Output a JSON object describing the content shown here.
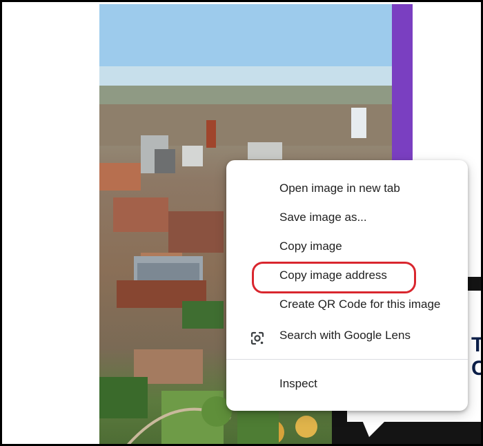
{
  "context_menu": {
    "items": [
      {
        "label": "Open image in new tab"
      },
      {
        "label": "Save image as..."
      },
      {
        "label": "Copy image"
      },
      {
        "label": "Copy image address"
      },
      {
        "label": "Create QR Code for this image"
      },
      {
        "label": "Search with Google Lens",
        "icon": "google-lens-icon"
      }
    ],
    "inspect_label": "Inspect",
    "highlighted_item": "Copy image address"
  },
  "background": {
    "partial_text": "T\nCL"
  },
  "colors": {
    "accent_bar": "#7a3fc1",
    "highlight_ring": "#d9262e",
    "text_dark": "#0c1f49"
  }
}
